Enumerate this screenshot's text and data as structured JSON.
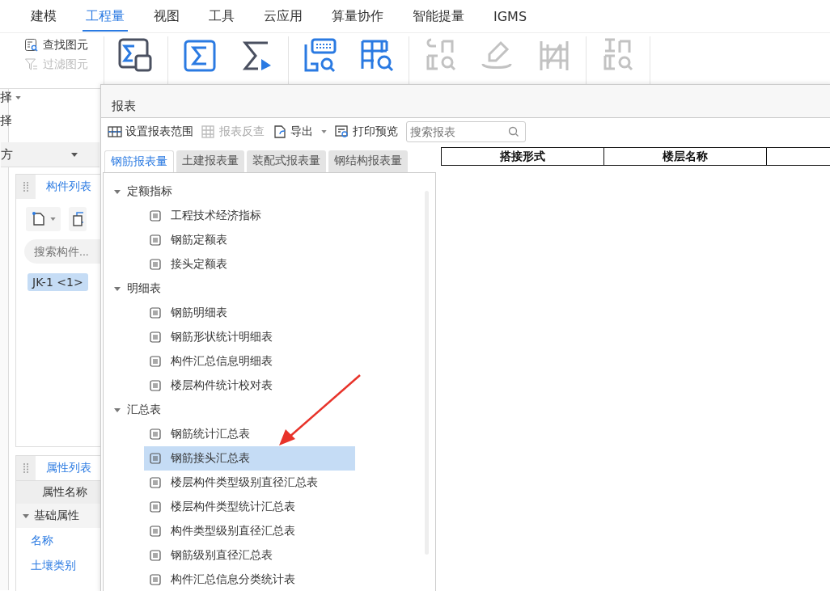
{
  "menu": [
    {
      "label": "建模",
      "selected": false
    },
    {
      "label": "工程量",
      "selected": true
    },
    {
      "label": "视图",
      "selected": false
    },
    {
      "label": "工具",
      "selected": false
    },
    {
      "label": "云应用",
      "selected": false
    },
    {
      "label": "算量协作",
      "selected": false
    },
    {
      "label": "智能提量",
      "selected": false
    },
    {
      "label": "IGMS",
      "selected": false
    }
  ],
  "ribbon": {
    "side_labels": [
      {
        "label": "择",
        "dropdown": true
      },
      {
        "label": "择",
        "dropdown": false
      }
    ],
    "find_items": [
      {
        "label": "查找图元",
        "disabled": false,
        "kind": "find"
      },
      {
        "label": "过滤图元",
        "disabled": true,
        "kind": "filter"
      }
    ],
    "groups": [
      {
        "buttons": [
          {
            "kind": "calc",
            "disabled": false
          }
        ]
      },
      {
        "buttons": [
          {
            "kind": "sum",
            "disabled": false
          },
          {
            "kind": "sum-select",
            "disabled": false
          }
        ]
      },
      {
        "buttons": [
          {
            "kind": "formula",
            "disabled": false
          },
          {
            "kind": "quantity",
            "disabled": false
          }
        ]
      },
      {
        "buttons": [
          {
            "kind": "rebar-view",
            "disabled": true
          },
          {
            "kind": "rebar-edit",
            "disabled": true
          },
          {
            "kind": "rebar-3d",
            "disabled": true
          }
        ]
      },
      {
        "buttons": [
          {
            "kind": "model-view",
            "disabled": true
          }
        ]
      }
    ]
  },
  "floor_selector": {
    "value": "方"
  },
  "component_pane": {
    "title": "构件列表",
    "search": {
      "placeholder": "搜索构件..."
    },
    "items": [
      {
        "label": "JK-1  <1>",
        "selected": true
      }
    ]
  },
  "property_pane": {
    "title": "属性列表",
    "column": "属性名称",
    "groups": [
      {
        "label": "基础属性",
        "expanded": true,
        "children": [
          {
            "label": "名称"
          },
          {
            "label": "土壤类别"
          }
        ]
      }
    ]
  },
  "dialog": {
    "title": "报表",
    "toolbar": [
      {
        "label": "设置报表范围",
        "kind": "range",
        "disabled": false,
        "dropdown": false
      },
      {
        "label": "报表反查",
        "kind": "lookup",
        "disabled": true,
        "dropdown": false
      },
      {
        "label": "导出",
        "kind": "export",
        "disabled": false,
        "dropdown": true
      },
      {
        "label": "打印预览",
        "kind": "print",
        "disabled": false,
        "dropdown": false
      }
    ],
    "search": {
      "placeholder": "搜索报表"
    },
    "tabs": [
      {
        "label": "钢筋报表量",
        "selected": true
      },
      {
        "label": "土建报表量",
        "selected": false
      },
      {
        "label": "装配式报表量",
        "selected": false
      },
      {
        "label": "钢结构报表量",
        "selected": false
      }
    ],
    "tree": [
      {
        "label": "定额指标",
        "expanded": true,
        "children": [
          {
            "label": "工程技术经济指标",
            "selected": false
          },
          {
            "label": "钢筋定额表",
            "selected": false
          },
          {
            "label": "接头定额表",
            "selected": false
          }
        ]
      },
      {
        "label": "明细表",
        "expanded": true,
        "children": [
          {
            "label": "钢筋明细表",
            "selected": false
          },
          {
            "label": "钢筋形状统计明细表",
            "selected": false
          },
          {
            "label": "构件汇总信息明细表",
            "selected": false
          },
          {
            "label": "楼层构件统计校对表",
            "selected": false
          }
        ]
      },
      {
        "label": "汇总表",
        "expanded": true,
        "children": [
          {
            "label": "钢筋统计汇总表",
            "selected": false
          },
          {
            "label": "钢筋接头汇总表",
            "selected": true
          },
          {
            "label": "楼层构件类型级别直径汇总表",
            "selected": false
          },
          {
            "label": "楼层构件类型统计汇总表",
            "selected": false
          },
          {
            "label": "构件类型级别直径汇总表",
            "selected": false
          },
          {
            "label": "钢筋级别直径汇总表",
            "selected": false
          },
          {
            "label": "构件汇总信息分类统计表",
            "selected": false
          }
        ]
      }
    ],
    "table": {
      "columns": [
        "搭接形式",
        "楼层名称"
      ]
    }
  }
}
